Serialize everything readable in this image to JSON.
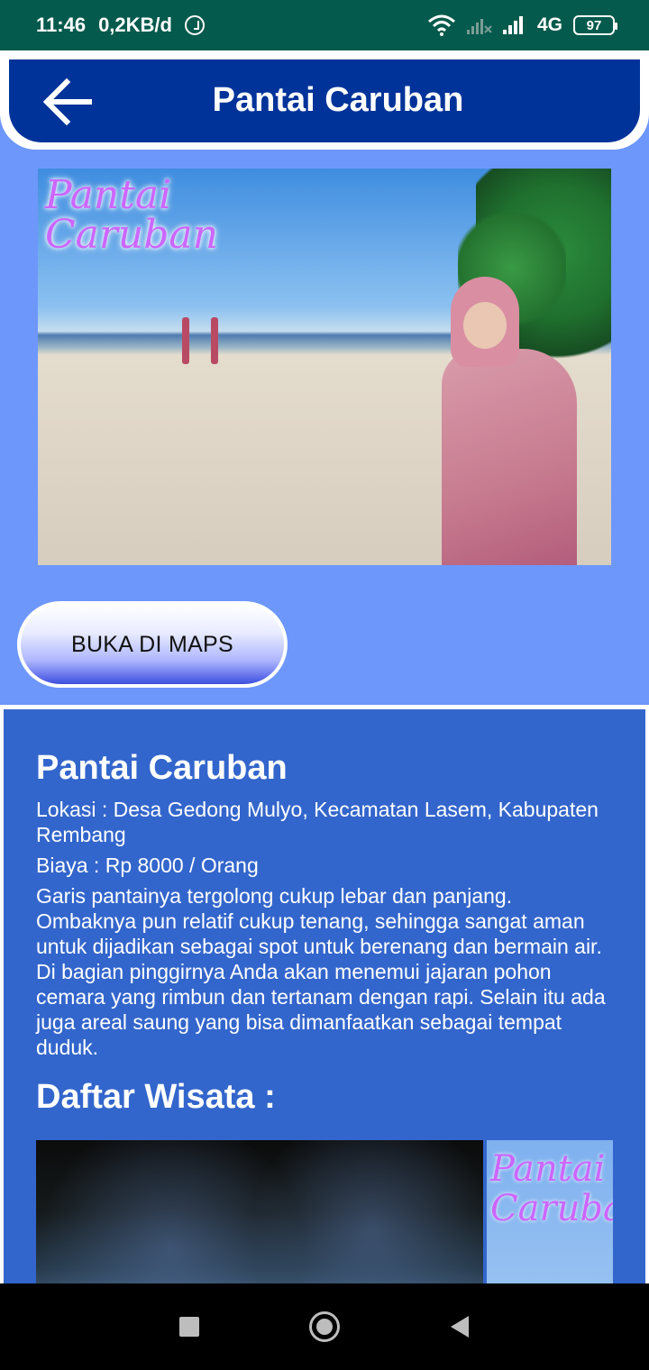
{
  "status_bar": {
    "time": "11:46",
    "data_rate": "0,2KB/d",
    "network": "4G",
    "battery": "97",
    "icons": [
      "alarm-icon",
      "wifi-icon",
      "signal-icon",
      "battery-icon"
    ]
  },
  "app_bar": {
    "title": "Pantai Caruban",
    "back_icon": "arrow-left-icon"
  },
  "hero": {
    "logo_line1": "Pantai",
    "logo_line2": "Caruban"
  },
  "maps_button": {
    "label": "BUKA DI MAPS"
  },
  "info": {
    "title": "Pantai Caruban",
    "location": "Lokasi : Desa Gedong Mulyo, Kecamatan Lasem, Kabupaten Rembang",
    "cost": "Biaya : Rp 8000 / Orang",
    "description": "Garis pantainya tergolong cukup lebar dan panjang. Ombaknya pun relatif cukup tenang, sehingga sangat aman untuk dijadikan sebagai spot untuk berenang dan bermain air. Di bagian pinggirnya Anda akan menemui jajaran pohon cemara yang rimbun dan tertanam dengan rapi. Selain itu ada juga areal saung yang bisa dimanfaatkan sebagai tempat duduk."
  },
  "list": {
    "title": "Daftar Wisata :",
    "gallery_logo_line1": "Pantai",
    "gallery_logo_line2": "Caruban"
  },
  "nav_bar": {
    "icons": [
      "recents-square-icon",
      "home-circle-icon",
      "back-triangle-icon"
    ]
  },
  "colors": {
    "status_bar": "#045a4c",
    "app_bar": "#003399",
    "page_background": "#6d97fb",
    "info_background": "#3366cc"
  }
}
